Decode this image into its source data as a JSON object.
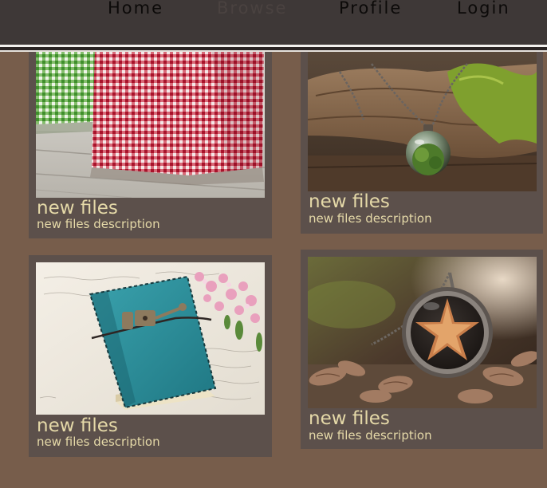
{
  "nav": {
    "items": [
      {
        "label": "Home"
      },
      {
        "label": "Browse"
      },
      {
        "label": "Profile"
      },
      {
        "label": "Login"
      }
    ]
  },
  "cards": [
    {
      "title": "new files",
      "description": "new files description",
      "image": "gingham-bags-photo"
    },
    {
      "title": "new files",
      "description": "new files description",
      "image": "moss-terrarium-pendant-photo"
    },
    {
      "title": "new files",
      "description": "new files description",
      "image": "teal-leather-journal-photo"
    },
    {
      "title": "new files",
      "description": "new files description",
      "image": "starfish-locket-photo"
    }
  ],
  "colors": {
    "page_background": "#775d4b",
    "navbar": "#3e3837",
    "card": "#5c504b",
    "card_text": "#e5d9a8"
  }
}
